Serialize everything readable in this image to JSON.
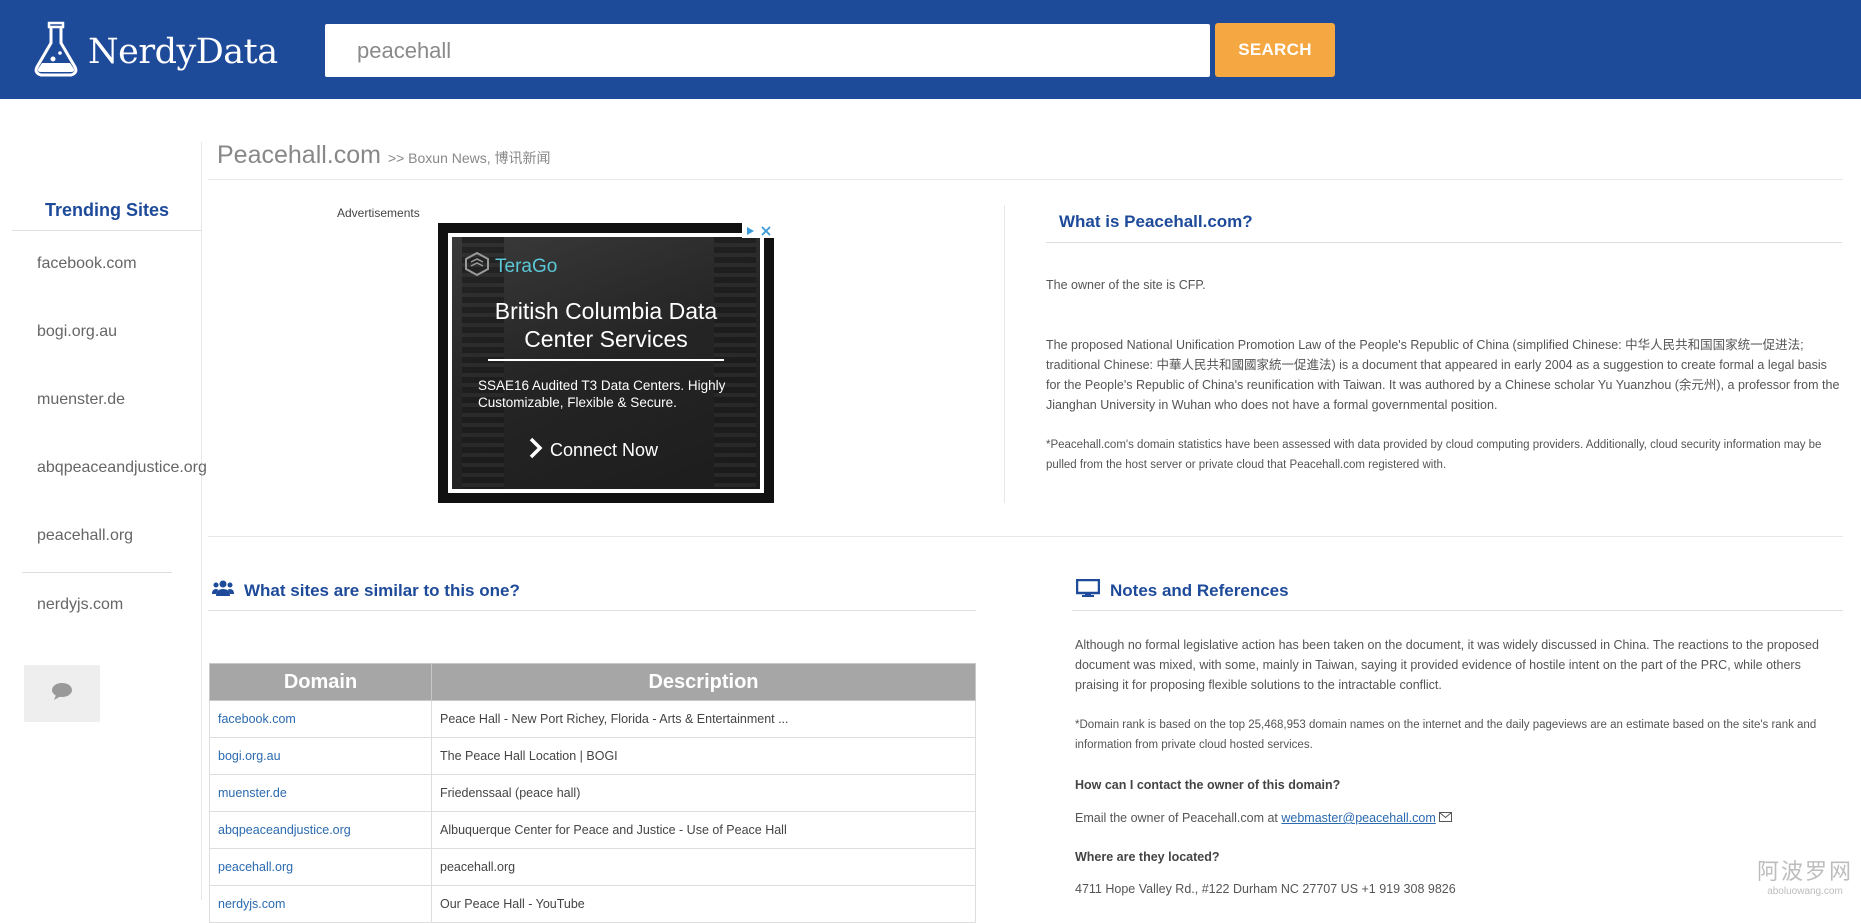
{
  "header": {
    "logo_text": "NerdyData",
    "search_value": "peacehall",
    "search_button": "SEARCH"
  },
  "sidebar": {
    "title": "Trending Sites",
    "items": [
      "facebook.com",
      "bogi.org.au",
      "muenster.de",
      "abqpeaceandjustice.org",
      "peacehall.org",
      "nerdyjs.com"
    ]
  },
  "page": {
    "title": "Peacehall.com",
    "subtitle": ">> Boxun News, 博讯新闻"
  },
  "ad": {
    "label": "Advertisements",
    "brand": "TeraGo",
    "headline_1": "British Columbia Data",
    "headline_2": "Center Services",
    "body": "SSAE16 Audited T3 Data Centers. Highly Customizable, Flexible & Secure.",
    "cta": "Connect Now"
  },
  "what": {
    "title": "What is Peacehall.com?",
    "p1": "The owner of the site is CFP.",
    "p2": "The proposed National Unification Promotion Law of the People's Republic of China (simplified Chinese: 中华人民共和国国家统一促进法; traditional Chinese: 中華人民共和國國家統一促進法) is a document that appeared in early 2004 as a suggestion to create formal a legal basis for the People's Republic of China's reunification with Taiwan. It was authored by a Chinese scholar Yu Yuanzhou (余元州), a professor from the Jianghan University in Wuhan who does not have a formal governmental position.",
    "p3": "*Peacehall.com's domain statistics have been assessed with data provided by cloud computing providers. Additionally, cloud security information may be pulled from the host server or private cloud that Peacehall.com registered with."
  },
  "similar": {
    "title": "What sites are similar to this one?",
    "col_domain": "Domain",
    "col_description": "Description",
    "rows": [
      {
        "domain": "facebook.com",
        "description": "Peace Hall - New Port Richey, Florida - Arts & Entertainment ..."
      },
      {
        "domain": "bogi.org.au",
        "description": "The Peace Hall Location | BOGI"
      },
      {
        "domain": "muenster.de",
        "description": "Friedenssaal (peace hall)"
      },
      {
        "domain": "abqpeaceandjustice.org",
        "description": "Albuquerque Center for Peace and Justice - Use of Peace Hall"
      },
      {
        "domain": "peacehall.org",
        "description": "peacehall.org"
      },
      {
        "domain": "nerdyjs.com",
        "description": "Our Peace Hall - YouTube"
      }
    ]
  },
  "notes": {
    "title": "Notes and References",
    "p1": "Although no formal legislative action has been taken on the document, it was widely discussed in China. The reactions to the proposed document was mixed, with some, mainly in Taiwan, saying it provided evidence of hostile intent on the part of the PRC, while others praising it for proposing flexible solutions to the intractable conflict.",
    "p2": "*Domain rank is based on the top 25,468,953 domain names on the internet and the daily pageviews are an estimate based on the site's rank and information from private cloud hosted services.",
    "contact_q": "How can I contact the owner of this domain?",
    "contact_prefix": "Email the owner of Peacehall.com at",
    "contact_email": "webmaster@peacehall.com",
    "location_q": "Where are they located?",
    "address": "4711 Hope Valley Rd., #122 Durham NC 27707 US +1 919 308 9826"
  },
  "watermark": {
    "line1": "阿波罗网",
    "line2": "aboluowang.com"
  }
}
